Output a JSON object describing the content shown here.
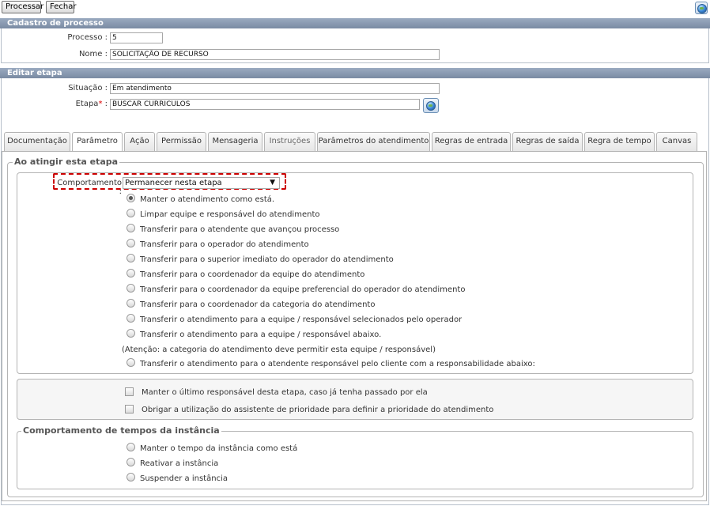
{
  "toolbar": {
    "process_label": "Processar",
    "close_label": "Fechar"
  },
  "cadastro": {
    "header": "Cadastro de processo",
    "processo_label": "Processo :",
    "processo_value": "5",
    "nome_label": "Nome :",
    "nome_value": "SOLICITAÇÃO DE RECURSO"
  },
  "editar": {
    "header": "Editar etapa",
    "situacao_label": "Situação :",
    "situacao_value": "Em atendimento",
    "etapa_label": "Etapa",
    "etapa_required": "*",
    "etapa_colon": " :",
    "etapa_value": "BUSCAR CURRICULOS"
  },
  "tabs": [
    {
      "label": "Documentação"
    },
    {
      "label": "Parâmetro"
    },
    {
      "label": "Ação"
    },
    {
      "label": "Permissão"
    },
    {
      "label": "Mensageria"
    },
    {
      "label": "Instruções"
    },
    {
      "label": "Parâmetros do atendimento"
    },
    {
      "label": "Regras de entrada"
    },
    {
      "label": "Regras de saída"
    },
    {
      "label": "Regra de tempo"
    },
    {
      "label": "Canvas"
    }
  ],
  "ao_atingir": {
    "title": "Ao atingir esta etapa",
    "comportamento_label": "Comportamento :",
    "comportamento_value": "Permanecer nesta etapa",
    "options": [
      "Manter o atendimento como está.",
      "Limpar equipe e responsável do atendimento",
      "Transferir para o atendente que avançou processo",
      "Transferir para o operador do atendimento",
      "Transferir para o superior imediato do operador do atendimento",
      "Transferir para o coordenador da equipe do atendimento",
      "Transferir para o coordenador da equipe preferencial do operador do atendimento",
      "Transferir para o coordenador da categoria do atendimento",
      "Transferir o atendimento para a equipe / responsável selecionados pelo operador",
      "Transferir o atendimento para a equipe / responsável abaixo."
    ],
    "attention_note": "(Atenção: a categoria do atendimento deve permitir esta equipe / responsável)",
    "option_last": "Transferir o atendimento para o atendente responsável pelo cliente com a responsabilidade abaixo:",
    "checkbox_1": "Manter o último responsável desta etapa, caso já tenha passado por ela",
    "checkbox_2": "Obrigar a utilização do assistente de prioridade para definir a prioridade do atendimento"
  },
  "tempos": {
    "title": "Comportamento de tempos da instância",
    "options": [
      "Manter o tempo da instância como está",
      "Reativar a instância",
      "Suspender a instância"
    ]
  },
  "colors": {
    "header_bg": "#8a9bb2",
    "highlight": "#cc0000"
  }
}
